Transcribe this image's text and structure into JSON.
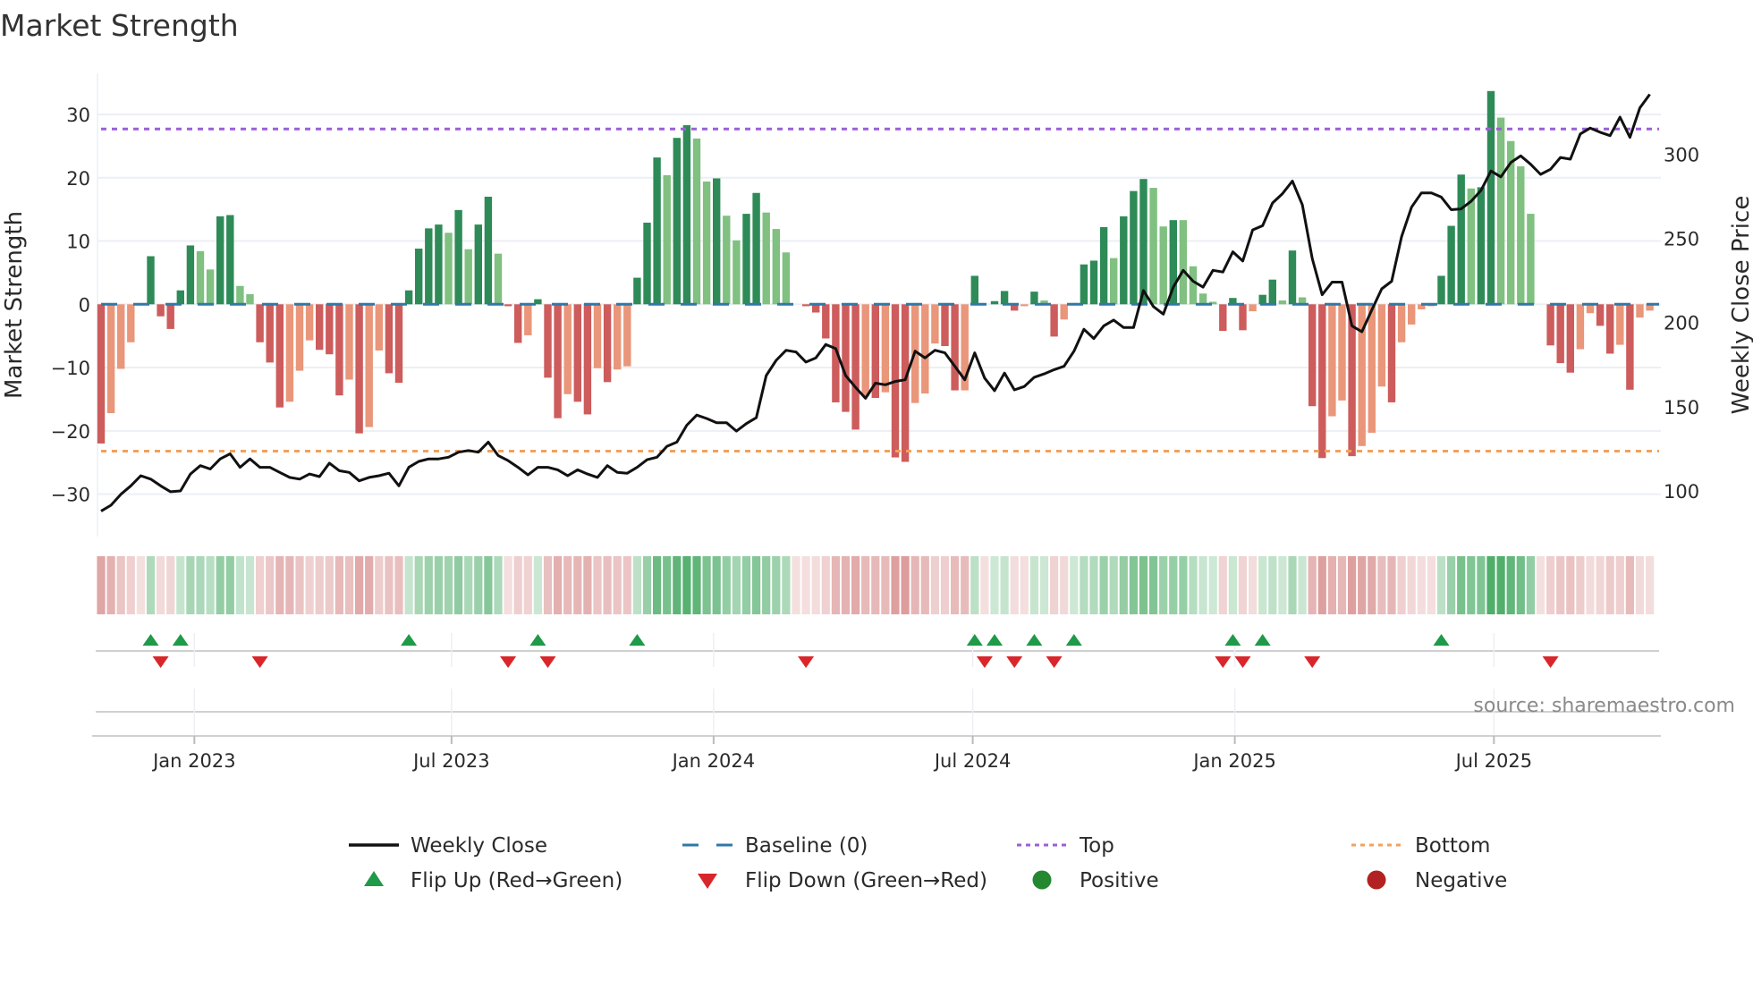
{
  "chart_data": {
    "type": "bar",
    "title": "Market Strength",
    "ylabel": "Market Strength",
    "y2label": "Weekly Close Price",
    "ylim": [
      -36.7,
      36.5
    ],
    "y2lim": [
      72.9,
      348
    ],
    "yticks": [
      30,
      20,
      10,
      0,
      -10,
      -20,
      -30
    ],
    "yticks_labels": [
      "30",
      "20",
      "10",
      "0",
      "−10",
      "−20",
      "−30"
    ],
    "y2ticks": [
      300,
      250,
      200,
      150,
      100
    ],
    "y2ticks_labels": [
      "300",
      "250",
      "200",
      "150",
      "100"
    ],
    "x_unit": "week index",
    "xticks": [
      {
        "week": 9.4,
        "label": "Jan 2023"
      },
      {
        "week": 35.3,
        "label": "Jul 2023"
      },
      {
        "week": 61.7,
        "label": "Jan 2024"
      },
      {
        "week": 87.8,
        "label": "Jul 2024"
      },
      {
        "week": 114.2,
        "label": "Jan 2025"
      },
      {
        "week": 140.3,
        "label": "Jul 2025"
      }
    ],
    "grid": true,
    "top_level": 27.7,
    "bottom_level": -23.2,
    "baseline": 0,
    "strength": [
      -22,
      -17.2,
      -10.2,
      -6,
      0,
      7.6,
      -1.9,
      -3.9,
      2.2,
      9.3,
      8.4,
      5.5,
      13.9,
      14.1,
      2.9,
      1.6,
      -6,
      -9.2,
      -16.3,
      -15.4,
      -10.5,
      -5.7,
      -7.2,
      -7.9,
      -14.4,
      -11.9,
      -20.4,
      -19.4,
      -7.3,
      -10.9,
      -12.4,
      2.2,
      8.8,
      12,
      12.6,
      11.3,
      14.9,
      8.7,
      12.6,
      17,
      8,
      -0.3,
      -6.1,
      -4.9,
      0.8,
      -11.6,
      -18,
      -14.2,
      -15.4,
      -17.4,
      -10.1,
      -12.3,
      -10.3,
      -9.8,
      4.2,
      12.9,
      23.2,
      20.4,
      26.3,
      28.3,
      26.2,
      19.4,
      19.9,
      14,
      10.1,
      14.3,
      17.6,
      14.5,
      11.9,
      8.2,
      0,
      -0.3,
      -1.3,
      -5.4,
      -15.5,
      -17,
      -19.8,
      -14.5,
      -14.8,
      -13.9,
      -24.2,
      -24.9,
      -15.6,
      -14.1,
      -6.2,
      -6.6,
      -13.6,
      -13.6,
      4.5,
      0,
      0.5,
      2.1,
      -1,
      -0.3,
      2,
      0.6,
      -5.1,
      -2.4,
      0.2,
      6.3,
      6.9,
      12.2,
      7.3,
      13.9,
      17.9,
      19.8,
      18.4,
      12.3,
      13.3,
      13.3,
      6,
      1.7,
      0.4,
      -4.2,
      1,
      -4.1,
      -1.1,
      1.5,
      3.9,
      0.6,
      8.5,
      1.1,
      -16.1,
      -24.3,
      -17.7,
      -15.2,
      -24,
      -22.4,
      -20.3,
      -13,
      -15.5,
      -6,
      -3.2,
      -0.8,
      -0.3,
      4.5,
      12.4,
      20.5,
      18.3,
      18.5,
      33.7,
      29.5,
      25.8,
      21.8,
      14.3,
      0,
      -6.5,
      -9.3,
      -10.8,
      -7.1,
      -1.4,
      -3.4,
      -7.8,
      -6.4,
      -13.5,
      -2.1,
      -1
    ],
    "weekly_close": [
      88,
      91.5,
      98,
      103,
      109,
      107,
      103,
      99.5,
      100,
      110,
      115,
      113,
      119,
      122,
      114,
      119,
      114,
      114,
      111,
      108,
      107,
      110,
      108.5,
      116.5,
      112,
      111,
      106,
      108,
      109,
      110.5,
      103,
      114,
      117.5,
      119,
      119,
      120,
      123,
      124,
      123,
      129,
      121,
      118,
      114,
      109.5,
      114,
      114,
      112.5,
      109,
      112.5,
      110,
      108,
      115,
      111,
      110.5,
      114,
      118.5,
      120,
      126.5,
      129,
      139,
      145,
      143,
      140.5,
      140.5,
      135.5,
      140,
      143.5,
      168.5,
      177.5,
      183.5,
      182.5,
      176.5,
      179,
      187,
      184.5,
      168.5,
      161.5,
      155,
      164,
      163,
      165,
      166,
      183,
      179,
      183.5,
      182,
      174,
      166,
      182,
      167,
      159.5,
      170,
      160,
      162,
      167.5,
      169.5,
      172,
      174,
      183,
      196,
      190.5,
      198,
      201.5,
      197,
      197,
      219,
      209.5,
      205,
      221,
      231,
      224.5,
      221,
      231,
      230,
      242,
      236.5,
      255,
      257.5,
      271,
      276.5,
      284,
      270,
      238,
      216.5,
      224,
      224,
      198,
      194.5,
      207.5,
      220,
      224.5,
      251,
      268.5,
      277,
      277,
      274.5,
      267,
      267.5,
      272,
      278.5,
      290,
      286.5,
      295,
      299,
      294,
      288,
      291,
      298,
      297,
      312,
      315.5,
      313,
      311,
      322,
      310,
      327.5,
      335.5
    ],
    "flip_up_weeks": [
      5,
      8,
      31,
      44,
      54,
      88,
      90,
      94,
      98,
      114,
      117,
      135
    ],
    "flip_down_weeks": [
      6,
      16,
      41,
      45,
      71,
      89,
      92,
      96,
      113,
      115,
      122,
      146
    ],
    "legend": {
      "placement": "bottom",
      "items": [
        {
          "label": "Weekly Close",
          "symbol": "line",
          "color": "#111111"
        },
        {
          "label": "Baseline (0)",
          "symbol": "dash",
          "color": "#2f78a8"
        },
        {
          "label": "Top",
          "symbol": "dot",
          "color": "#9b5fd6"
        },
        {
          "label": "Bottom",
          "symbol": "dot",
          "color": "#f2a15c"
        },
        {
          "label": "Flip Up (Red→Green)",
          "symbol": "triangle-up",
          "color": "#1e9a48"
        },
        {
          "label": "Flip Down (Green→Red)",
          "symbol": "triangle-down",
          "color": "#d9262a"
        },
        {
          "label": "Positive",
          "symbol": "circle",
          "color": "#23882f"
        },
        {
          "label": "Negative",
          "symbol": "circle",
          "color": "#b22222"
        }
      ]
    },
    "annotation": "source: sharemaestro.com",
    "colors": {
      "green_dark": "#2e8b57",
      "green_light": "#80c080",
      "red_dark": "#cd5c5c",
      "red_light": "#e9967a",
      "grid": "#eceff5"
    }
  }
}
